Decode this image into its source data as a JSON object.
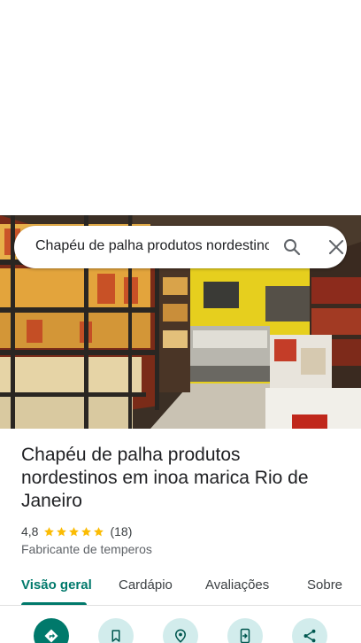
{
  "search": {
    "query": "Chapéu de palha produtos nordestinos em inoa marica Rio de Janeiro",
    "search_icon": "search-icon",
    "close_icon": "close-icon"
  },
  "place": {
    "title": "Chapéu de palha produtos nordestinos em inoa marica Rio de Janeiro",
    "rating": "4,8",
    "stars": 5,
    "reviews": "(18)",
    "category": "Fabricante de temperos",
    "star_color": "#fbbc04"
  },
  "tabs": [
    {
      "label": "Visão geral",
      "active": true
    },
    {
      "label": "Cardápio",
      "active": false
    },
    {
      "label": "Avaliações",
      "active": false
    },
    {
      "label": "Sobre",
      "active": false
    }
  ],
  "actions": [
    {
      "icon": "directions-icon",
      "primary": true
    },
    {
      "icon": "bookmark-icon",
      "primary": false
    },
    {
      "icon": "nearby-icon",
      "primary": false
    },
    {
      "icon": "send-to-phone-icon",
      "primary": false
    },
    {
      "icon": "share-icon",
      "primary": false
    }
  ],
  "colors": {
    "accent": "#00796b",
    "action_bg": "#d2ecec"
  }
}
